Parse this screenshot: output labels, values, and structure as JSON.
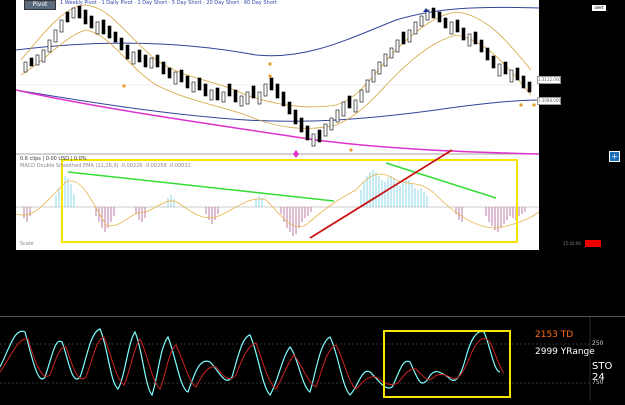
{
  "toolbar": {
    "pivot_label": "Pivot",
    "legend_text": "1 Weekly Pivot · 1 Daily Pivot · 1 Day Short · 5 Day Short · 20 Day Short · 60 Day Short",
    "badge": "alert"
  },
  "price_panel": {
    "price_tag_upper": "1.3112.000",
    "price_tag_lower": "1.3098.000"
  },
  "indicator": {
    "clips_label": "0.6 clips | 0.00 USD | 0.0%",
    "legend": "MACD Double Smoothed EMA (11,26,9) -0.00226 -0.00258 -0.00031"
  },
  "chart_footer": {
    "left_label": "Scale",
    "time_label": "15:42:00"
  },
  "stochastic": {
    "td_label": "2153 TD",
    "yrange_label": "2999 YRange",
    "sto_label": "STO 24",
    "level_upper": "250",
    "level_lower": "750"
  },
  "colors": {
    "yellow_box": "#f5e400",
    "green_trend": "#33dd33",
    "red_trend": "#cc1111",
    "magenta_ma": "#dd33cc",
    "blue_band": "#334499",
    "gold_band": "#d4a53a",
    "stoch_cyan": "#7fffff",
    "stoch_red": "#cc2222"
  }
}
